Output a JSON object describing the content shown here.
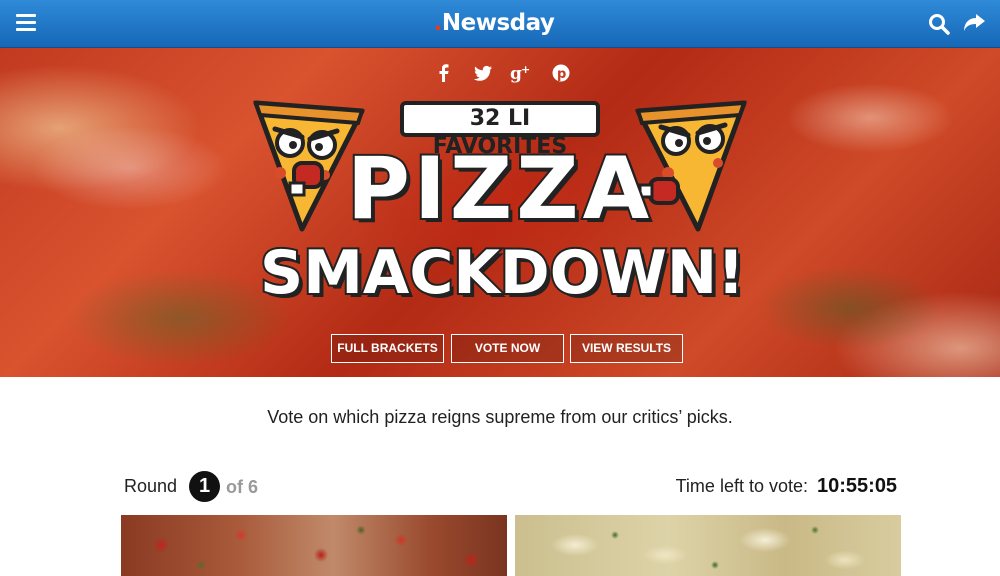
{
  "header": {
    "logo_text": "Newsday",
    "logo_dot": ".",
    "menu_icon": "hamburger-menu-icon",
    "search_icon": "search-icon",
    "share_icon": "share-arrow-icon",
    "bar_color": "#1f78c8"
  },
  "hero": {
    "social": [
      {
        "name": "facebook-icon",
        "glyph": "f"
      },
      {
        "name": "twitter-icon",
        "glyph": "🐦"
      },
      {
        "name": "google-plus-icon",
        "glyph": "g+"
      },
      {
        "name": "pinterest-icon",
        "glyph": "p"
      }
    ],
    "subtitle": "32 LI FAVORITES",
    "title_line1": "PIZZA",
    "title_line2": "SMACKDOWN!",
    "buttons": {
      "full_brackets": "FULL BRACKETS",
      "vote_now": "VOTE NOW",
      "view_results": "VIEW RESULTS"
    }
  },
  "main": {
    "tagline": "Vote on which pizza reigns supreme from our critics’ picks.",
    "round": {
      "label": "Round",
      "current": "1",
      "of_text": "of 6"
    },
    "timer": {
      "label": "Time left to vote:",
      "value": "10:55:05"
    }
  }
}
